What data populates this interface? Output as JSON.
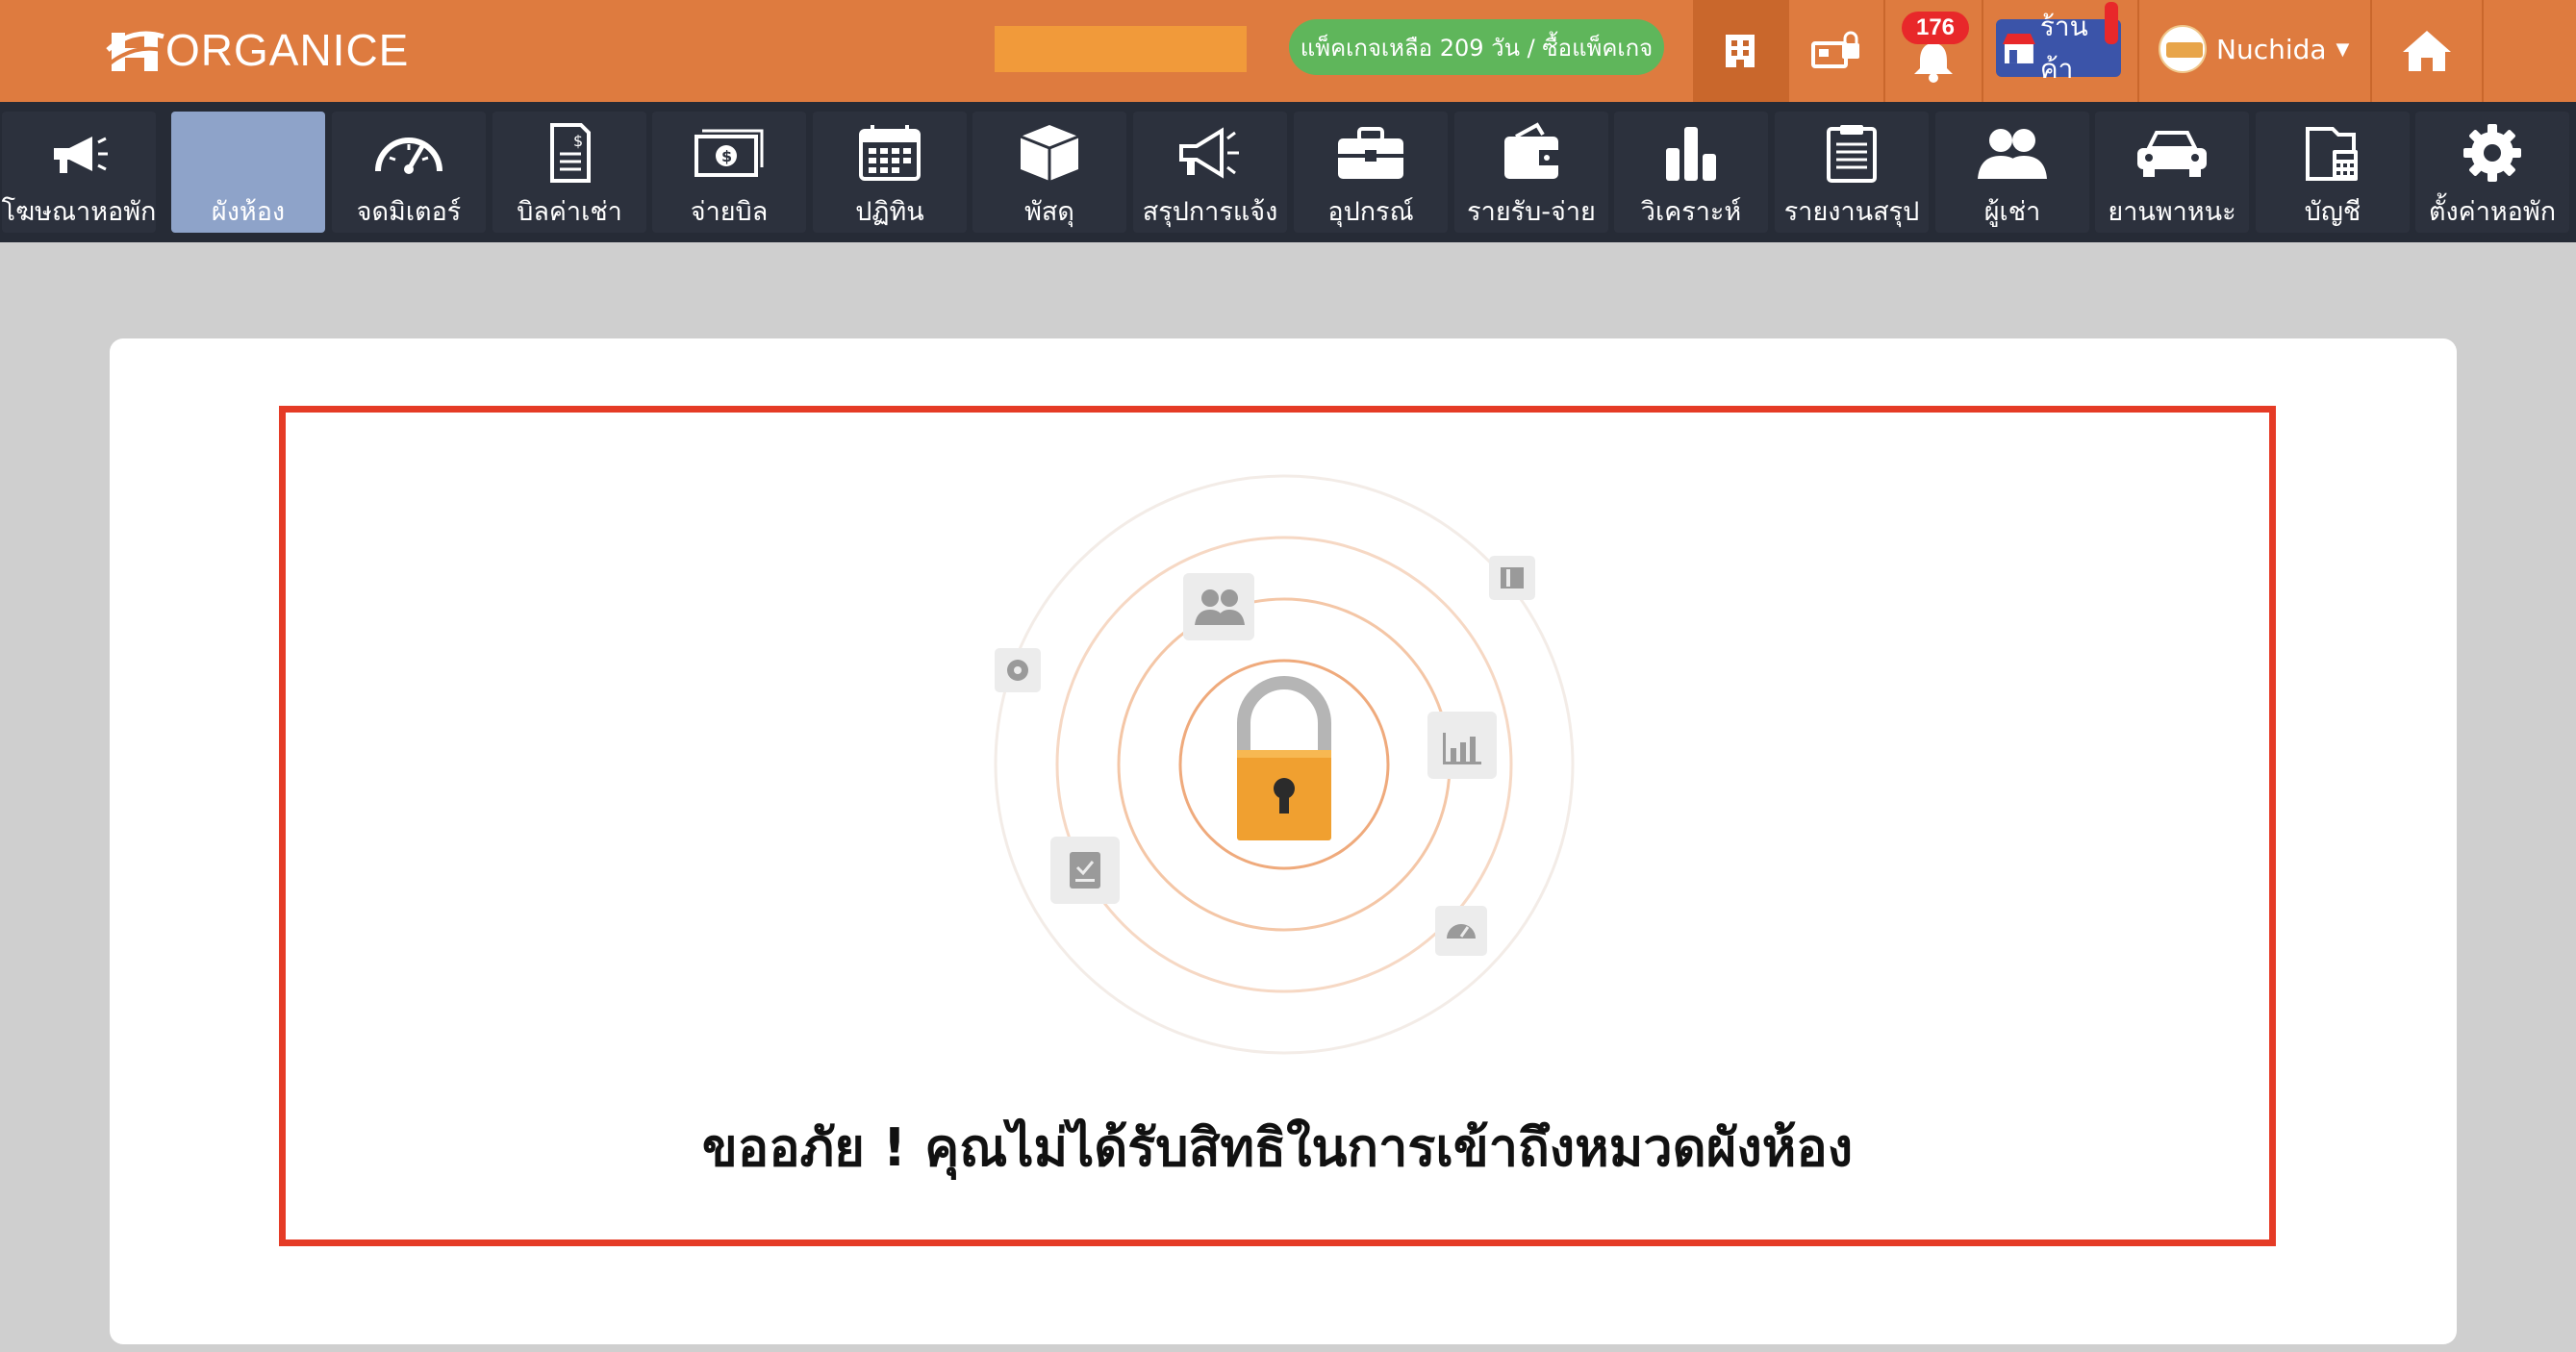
{
  "header": {
    "brand": "ORGANICE",
    "package_text": "แพ็คเกจเหลือ 209 วัน / ซื้อแพ็คเกจ",
    "notification_count": "176",
    "shop_label": "ร้านค้า",
    "user_name": "Nuchida",
    "icons": [
      "building-icon",
      "lock-switch-icon",
      "bell-icon",
      "shop-icon",
      "home-icon"
    ]
  },
  "nav": {
    "items": [
      {
        "label": "โฆษณาหอพัก",
        "icon": "megaphone-icon"
      },
      {
        "label": "ผังห้อง",
        "icon": "floor-plan-icon",
        "active": true
      },
      {
        "label": "จดมิเตอร์",
        "icon": "gauge-icon"
      },
      {
        "label": "บิลค่าเช่า",
        "icon": "invoice-icon"
      },
      {
        "label": "จ่ายบิล",
        "icon": "cash-icon"
      },
      {
        "label": "ปฏิทิน",
        "icon": "calendar-icon"
      },
      {
        "label": "พัสดุ",
        "icon": "parcel-icon"
      },
      {
        "label": "สรุปการแจ้ง",
        "icon": "announce-icon"
      },
      {
        "label": "อุปกรณ์",
        "icon": "toolbox-icon"
      },
      {
        "label": "รายรับ-จ่าย",
        "icon": "wallet-icon"
      },
      {
        "label": "วิเคราะห์",
        "icon": "bar-chart-icon"
      },
      {
        "label": "รายงานสรุป",
        "icon": "clipboard-icon"
      },
      {
        "label": "ผู้เช่า",
        "icon": "users-icon"
      },
      {
        "label": "ยานพาหนะ",
        "icon": "car-icon"
      },
      {
        "label": "บัญชี",
        "icon": "accounting-icon"
      },
      {
        "label": "ตั้งค่าหอพัก",
        "icon": "gear-icon"
      }
    ]
  },
  "main": {
    "message": "ขออภัย ! คุณไม่ได้รับสิทธิในการเข้าถึงหมวดผังห้อง"
  },
  "colors": {
    "header_bg": "#de7b3f",
    "nav_bg": "#262b36",
    "nav_active": "#8ea3c9",
    "frame": "#e53b26",
    "lock": "#f0a030",
    "package_pill": "#5fb65b"
  }
}
